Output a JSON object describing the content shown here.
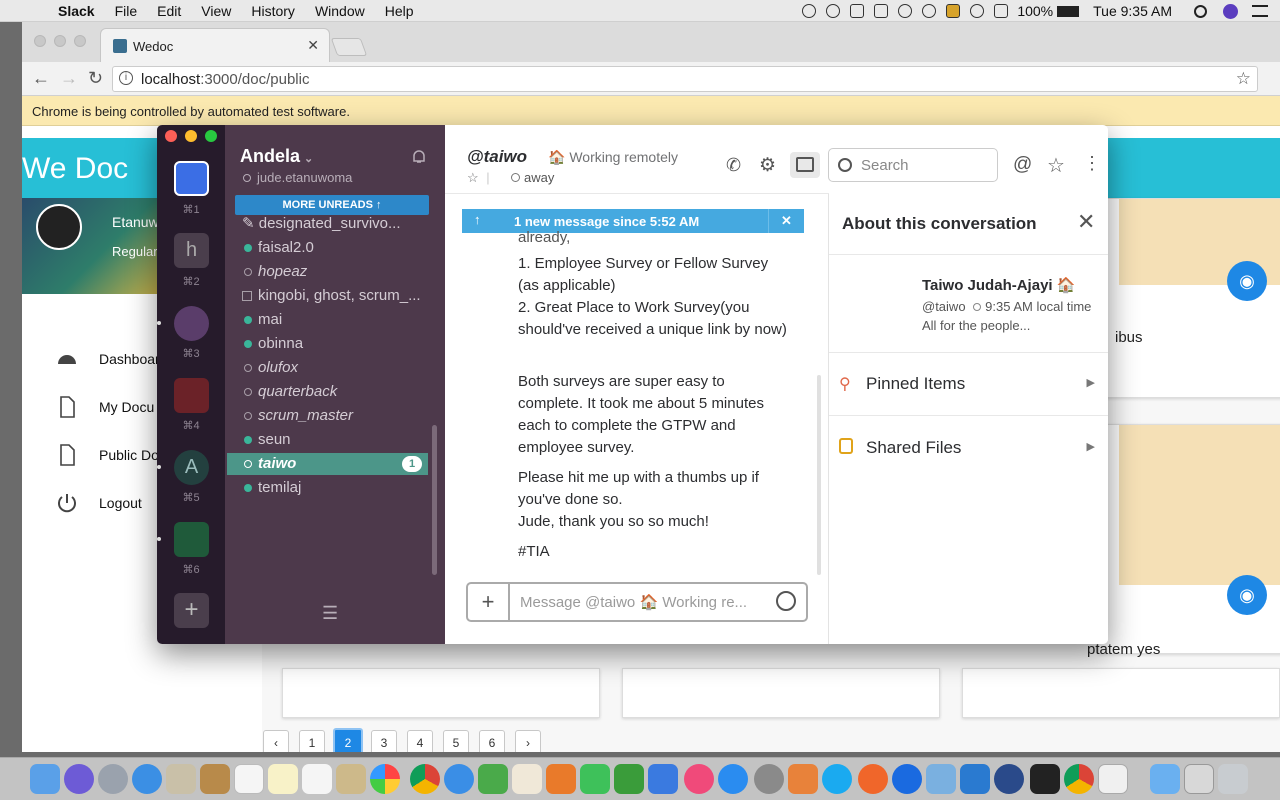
{
  "menubar": {
    "app": "Slack",
    "items": [
      "File",
      "Edit",
      "View",
      "History",
      "Window",
      "Help"
    ],
    "battery": "100%",
    "clock": "Tue 9:35 AM"
  },
  "browser": {
    "tab_title": "Wedoc",
    "url_host": "localhost",
    "url_path": ":3000/doc/public",
    "infobar": "Chrome is being controlled by automated test software."
  },
  "wedoc": {
    "brand": "We Doc",
    "profile_name": "Etanuw",
    "profile_role": "Regular",
    "nav": [
      {
        "label": "Dashboard",
        "icon": "dashboard-icon"
      },
      {
        "label": "My Docu",
        "icon": "document-icon"
      },
      {
        "label": "Public Do",
        "icon": "document-icon"
      },
      {
        "label": "Logout",
        "icon": "power-icon"
      }
    ],
    "card_text_1": "ibus",
    "card_text_2": "ptatem yes",
    "pagination": [
      "‹",
      "1",
      "2",
      "3",
      "4",
      "5",
      "6",
      "›"
    ],
    "current_page": "2"
  },
  "slack": {
    "teams": [
      {
        "key": "⌘1",
        "letter": "",
        "color": "#3b6ee5"
      },
      {
        "key": "⌘2",
        "letter": "h",
        "color": "#4a3e4c"
      },
      {
        "key": "⌘3",
        "letter": "",
        "color": "#5a3d6a"
      },
      {
        "key": "⌘4",
        "letter": "",
        "color": "#6b2228"
      },
      {
        "key": "⌘5",
        "letter": "A",
        "color": "#23403f"
      },
      {
        "key": "⌘6",
        "letter": "",
        "color": "#1f5a3a"
      }
    ],
    "workspace": "Andela",
    "user": "jude.etanuwoma",
    "more_unreads": "MORE UNREADS",
    "channels": [
      {
        "name": "designated_survivo...",
        "status": "pencil",
        "italic": false
      },
      {
        "name": "faisal2.0",
        "status": "on",
        "italic": false
      },
      {
        "name": "hopeaz",
        "status": "off",
        "italic": true
      },
      {
        "name": "kingobi, ghost, scrum_...",
        "status": "group",
        "italic": false
      },
      {
        "name": "mai",
        "status": "on",
        "italic": false
      },
      {
        "name": "obinna",
        "status": "on",
        "italic": false
      },
      {
        "name": "olufox",
        "status": "off",
        "italic": true
      },
      {
        "name": "quarterback",
        "status": "off",
        "italic": true
      },
      {
        "name": "scrum_master",
        "status": "off",
        "italic": true
      },
      {
        "name": "seun",
        "status": "on",
        "italic": false
      },
      {
        "name": "taiwo",
        "status": "off",
        "italic": true,
        "active": true,
        "badge": "1"
      },
      {
        "name": "temilaj",
        "status": "on",
        "italic": false
      }
    ],
    "conversation": {
      "name": "@taiwo",
      "status_text": "Working remotely",
      "presence": "away",
      "banner": "1 new message since 5:52 AM",
      "messages": [
        "already,",
        "1. Employee Survey or Fellow Survey (as applicable)",
        "2. Great Place to Work Survey(you should've received a unique link by now)",
        "Both surveys are super easy to complete. It took me about 5 minutes each to complete the GTPW and employee survey.",
        "Please hit me up with a thumbs up if you've done so.",
        "Jude, thank you so so much!",
        "#TIA"
      ],
      "input_placeholder": "Message @taiwo 🏠 Working re..."
    },
    "search_placeholder": "Search",
    "about": {
      "title": "About this conversation",
      "name": "Taiwo Judah-Ajayi",
      "handle": "@taiwo",
      "local_time": "9:35 AM local time",
      "bio": "All for the people...",
      "pinned": "Pinned Items",
      "files": "Shared Files"
    }
  }
}
